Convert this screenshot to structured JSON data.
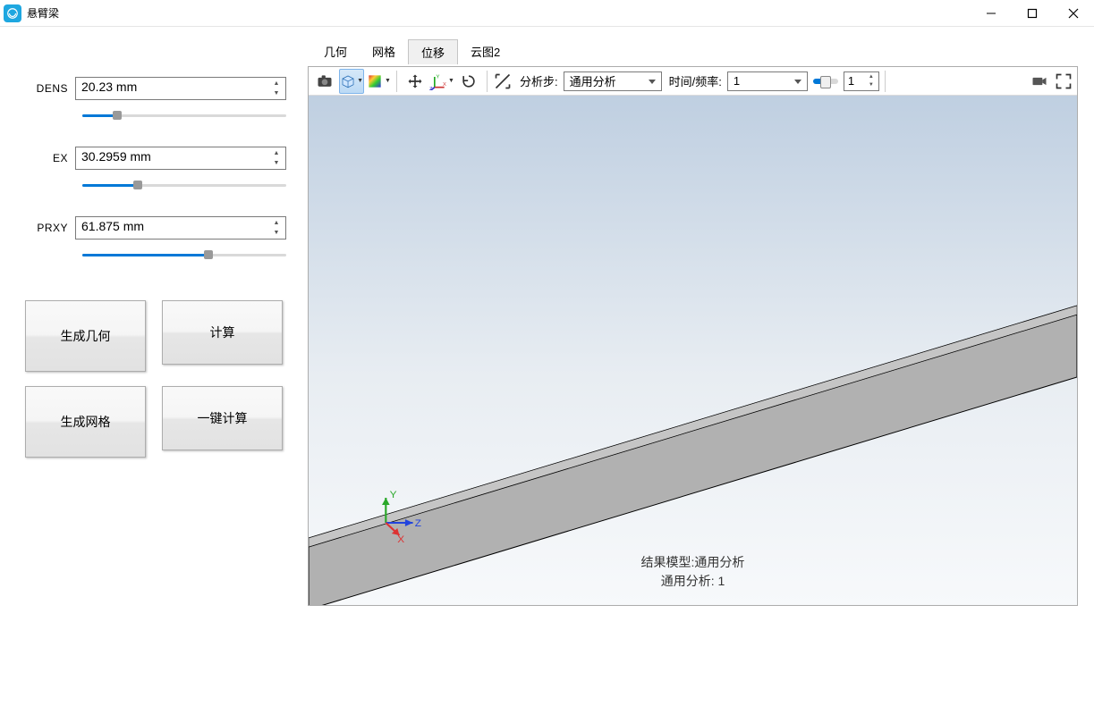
{
  "app": {
    "title": "悬臂梁"
  },
  "params": [
    {
      "label": "DENS",
      "value": "20.23 mm",
      "pct": 17
    },
    {
      "label": "EX",
      "value": "30.2959 mm",
      "pct": 27
    },
    {
      "label": "PRXY",
      "value": "61.875 mm",
      "pct": 62
    }
  ],
  "buttons": {
    "gen_geom": "生成几何",
    "calc": "计算",
    "gen_mesh": "生成网格",
    "one_calc": "一键计算"
  },
  "tabs": [
    {
      "label": "几何",
      "active": false
    },
    {
      "label": "网格",
      "active": false
    },
    {
      "label": "位移",
      "active": true
    },
    {
      "label": "云图2",
      "active": false
    }
  ],
  "toolbar": {
    "step_label": "分析步:",
    "step_value": "通用分析",
    "time_label": "时间/频率:",
    "time_value": "1",
    "frame_value": "1"
  },
  "viewer": {
    "caption1": "结果模型:通用分析",
    "caption2": "通用分析: 1",
    "axis_x": "X",
    "axis_y": "Y",
    "axis_z": "Z"
  }
}
